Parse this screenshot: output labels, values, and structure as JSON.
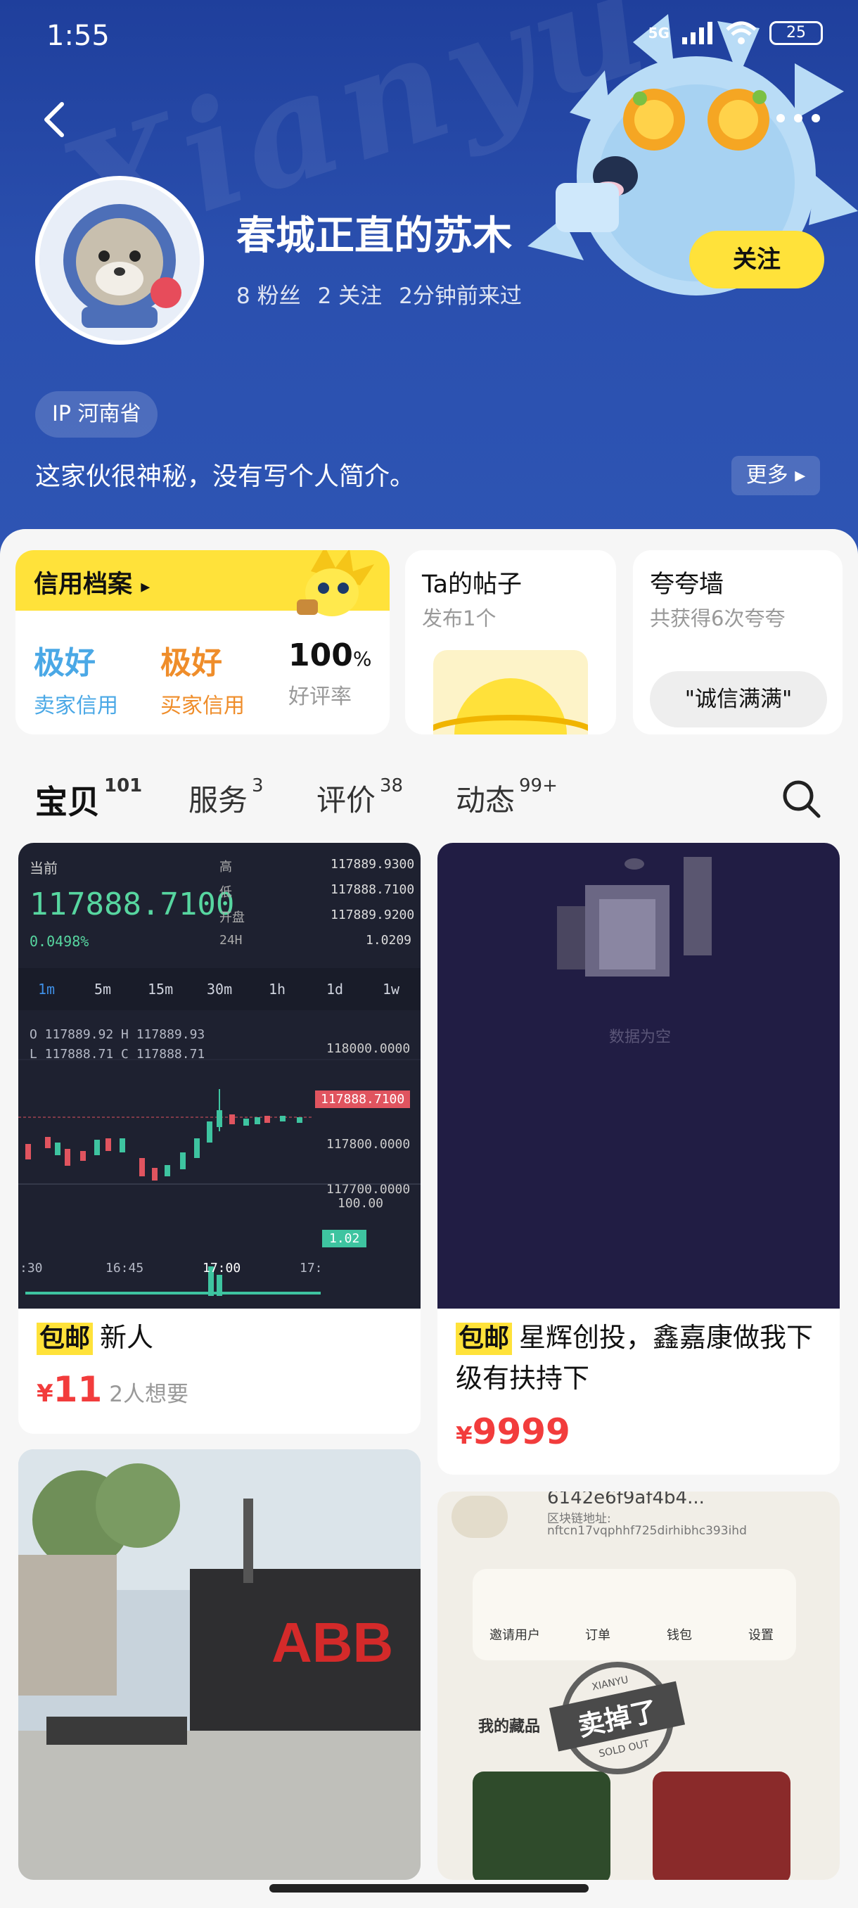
{
  "status_bar": {
    "time": "1:55",
    "network": "5G",
    "battery": "25"
  },
  "header": {
    "watermark": "Xianyu",
    "nickname": "春城正直的苏木",
    "stats": [
      "8 粉丝",
      "2 关注",
      "2分钟前来过"
    ],
    "follow_label": "关注",
    "ip_label": "IP 河南省",
    "bio": "这家伙很神秘，没有写个人简介。",
    "more_label": "更多"
  },
  "cards": {
    "credit": {
      "title": "信用档案",
      "seller": {
        "value": "极好",
        "label": "卖家信用"
      },
      "buyer": {
        "value": "极好",
        "label": "买家信用"
      },
      "rating": {
        "value": "100",
        "unit": "%",
        "label": "好评率"
      }
    },
    "posts": {
      "title": "Ta的帖子",
      "sub": "发布1个"
    },
    "boast": {
      "title": "夸夸墙",
      "sub": "共获得6次夸夸",
      "pill": "\"诚信满满\""
    }
  },
  "tabs": [
    {
      "label": "宝贝",
      "count": "101"
    },
    {
      "label": "服务",
      "count": "3"
    },
    {
      "label": "评价",
      "count": "38"
    },
    {
      "label": "动态",
      "count": "99+"
    }
  ],
  "items": [
    {
      "badge": "包邮",
      "title": "新人",
      "currency": "¥",
      "price": "11",
      "want": "2人想要"
    },
    {
      "badge": "包邮",
      "title": "星辉创投，鑫嘉康做我下级有扶持下",
      "currency": "¥",
      "price": "9999"
    }
  ],
  "chart_image": {
    "current_label": "当前",
    "current_price": "117888.7100",
    "change": "0.0498%",
    "stats": [
      {
        "label": "高",
        "value": "117889.9300"
      },
      {
        "label": "低",
        "value": "117888.7100"
      },
      {
        "label": "开盘",
        "value": "117889.9200"
      },
      {
        "label": "24H",
        "value": "1.0209"
      }
    ],
    "intervals": [
      "1m",
      "5m",
      "15m",
      "30m",
      "1h",
      "1d",
      "1w"
    ],
    "ohlc_1": "O  117889.92   H  117889.93",
    "ohlc_2": "L   117888.71   C  117888.71",
    "y_ticks": [
      "118000.0000",
      "117800.0000",
      "117700.0000"
    ],
    "last_price": "117888.7100",
    "vol_top": "100.00",
    "vol_last": "1.02",
    "x_ticks": [
      ":30",
      "16:45",
      "17:00",
      "17:"
    ]
  },
  "empty_image": {
    "text": "数据为空"
  },
  "abb_image": {
    "sign": "ABB"
  },
  "screenshot_image": {
    "line1": "6142e6f9af4b4...",
    "line2": "区块链地址:",
    "line3": "nftcn17vqphhf725dirhibhc393ihd",
    "menu": [
      "邀请用户",
      "订单",
      "钱包",
      "设置"
    ],
    "collection": "我的藏品",
    "stamp_top": "XIANYU",
    "stamp": "卖掉了",
    "stamp_bottom": "SOLD OUT"
  },
  "colors": {
    "header_blue": "#2a4fae",
    "accent_yellow": "#ffe23a",
    "price_red": "#f23c3c",
    "credit_blue": "#4aa8e6",
    "credit_orange": "#ef8d2a"
  }
}
